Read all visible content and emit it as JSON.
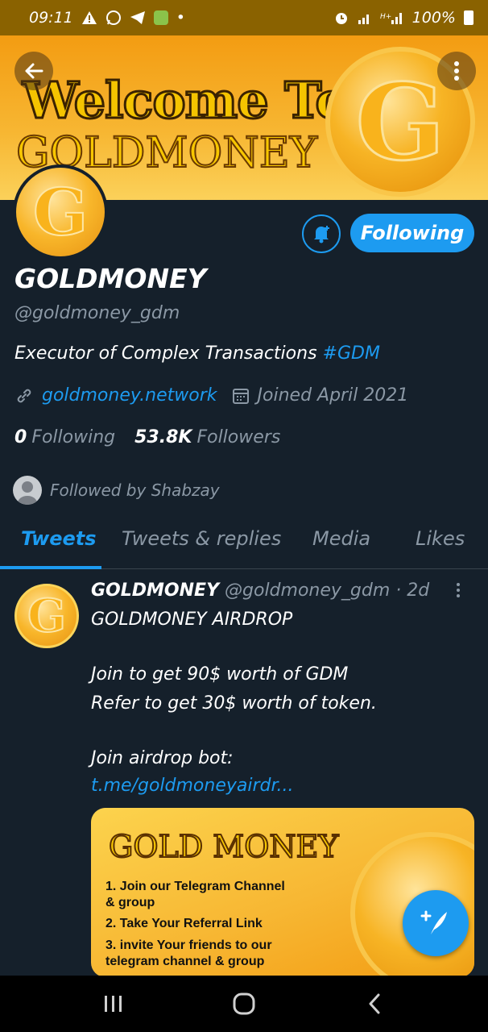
{
  "status_bar": {
    "time": "09:11",
    "battery": "100%"
  },
  "banner": {
    "title": "Welcome To",
    "subtitle": "GOLDMONEY",
    "coin_letter": "G"
  },
  "profile": {
    "avatar_letter": "G",
    "follow_button": "Following",
    "name": "GOLDMONEY",
    "handle": "@goldmoney_gdm",
    "bio": "Executor of Complex Transactions ",
    "bio_hashtag": "#GDM",
    "website": "goldmoney.network",
    "joined": "Joined April 2021",
    "following_count": "0",
    "following_label": "Following",
    "followers_count": "53.8K",
    "followers_label": "Followers",
    "followed_by": "Followed by Shabzay"
  },
  "tabs": [
    {
      "label": "Tweets",
      "active": true
    },
    {
      "label": "Tweets & replies",
      "active": false
    },
    {
      "label": "Media",
      "active": false
    },
    {
      "label": "Likes",
      "active": false
    }
  ],
  "tweet": {
    "avatar_letter": "G",
    "author": "GOLDMONEY",
    "meta": "@goldmoney_gdm · 2d",
    "line1": "GOLDMONEY AIRDROP",
    "line2": "Join to get 90$ worth of GDM",
    "line3": "Refer to get 30$ worth of token.",
    "line4": "Join airdrop bot:",
    "link": "t.me/goldmoneyairdr...",
    "image": {
      "title": "GOLD MONEY",
      "step1a": "1. Join our Telegram Channel",
      "step1b": "& group",
      "step2": "2. Take Your Referral Link",
      "step3a": "3. invite Your friends to our",
      "step3b": "telegram channel & group"
    }
  },
  "colors": {
    "accent": "#1d9bf0",
    "background": "#15202b",
    "muted": "#8b98a5",
    "gold": "#f7b733"
  },
  "icons": [
    "back-arrow-icon",
    "more-vertical-icon",
    "bell-plus-icon",
    "link-icon",
    "calendar-icon",
    "compose-icon",
    "recents-icon",
    "home-icon",
    "nav-back-icon"
  ]
}
